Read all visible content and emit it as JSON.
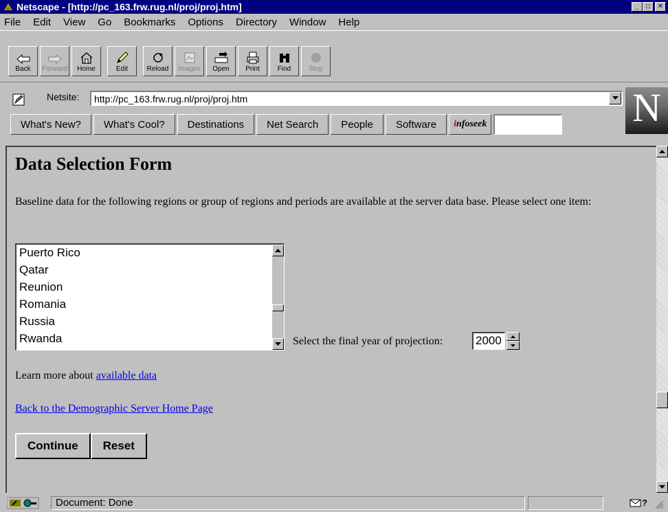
{
  "window": {
    "title": "Netscape - [http://pc_163.frw.rug.nl/proj/proj.htm]"
  },
  "menu": [
    "File",
    "Edit",
    "View",
    "Go",
    "Bookmarks",
    "Options",
    "Directory",
    "Window",
    "Help"
  ],
  "toolbar": {
    "back": "Back",
    "forward": "Forward",
    "home": "Home",
    "edit": "Edit",
    "reload": "Reload",
    "images": "Images",
    "open": "Open",
    "print": "Print",
    "find": "Find",
    "stop": "Stop"
  },
  "location": {
    "label": "Netsite:",
    "url": "http://pc_163.frw.rug.nl/proj/proj.htm"
  },
  "directory_buttons": [
    "What's New?",
    "What's Cool?",
    "Destinations",
    "Net Search",
    "People",
    "Software"
  ],
  "infoseek": {
    "i": "i",
    "rest": "nfoseek"
  },
  "content": {
    "title": "Data Selection Form",
    "intro": "Baseline data for the following regions or group of regions and periods are available at the server data base. Please select one item:",
    "regions": [
      "Puerto Rico",
      "Qatar",
      "Reunion",
      "Romania",
      "Russia",
      "Rwanda"
    ],
    "year_label": "Select the final year of projection:",
    "year_value": "2000",
    "learn_prefix": "Learn more about ",
    "learn_link": "available data",
    "back_link": "Back to the Demographic Server Home Page",
    "continue": "Continue",
    "reset": "Reset"
  },
  "status": {
    "text": "Document: Done"
  }
}
